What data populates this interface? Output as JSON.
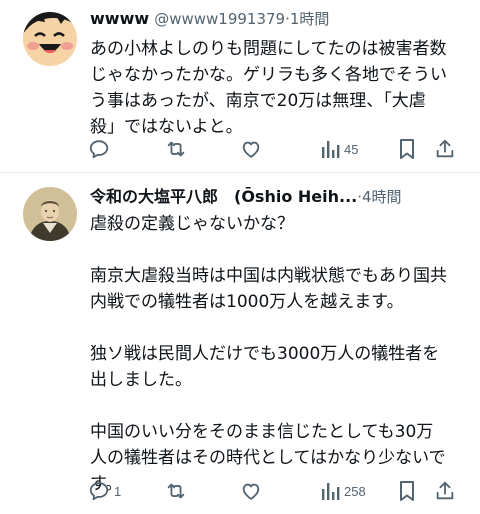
{
  "posts": [
    {
      "name": "wwww",
      "handle": "@wwww1991379",
      "separator": "·",
      "time": "1時間",
      "lines": [
        "あの小林よしのりも問題にしてたのは被害者数",
        "じゃなかったかな。ゲリラも多く各地でそうい",
        "う事はあったが、南京で20万は無理、「大虐",
        "殺」ではないよと。"
      ],
      "replies": "",
      "views": "45"
    },
    {
      "name": "令和の大塩平八郎　(Ōshio Heih...",
      "separator": "·",
      "time": "4時間",
      "lines": [
        "虐殺の定義じゃないかな？",
        "",
        "南京大虐殺当時は中国は内戦状態でもあり国共",
        "内戦での犠牲者は1000万人を越えます。",
        "",
        "独ソ戦は民間人だけでも3000万人の犠牲者を",
        "出しました。",
        "",
        "中国のいい分をそのまま信じたとしても30万",
        "人の犠牲者はその時代としてはかなり少ないで",
        "す。"
      ],
      "replies": "1",
      "views": "258"
    }
  ],
  "icons": {
    "reply": "reply-icon",
    "retweet": "retweet-icon",
    "like": "like-icon",
    "views": "views-icon",
    "bookmark": "bookmark-icon",
    "share": "share-icon"
  },
  "colors": {
    "text": "#0f1419",
    "secondary": "#536471",
    "divider": "#e6e8ea"
  }
}
